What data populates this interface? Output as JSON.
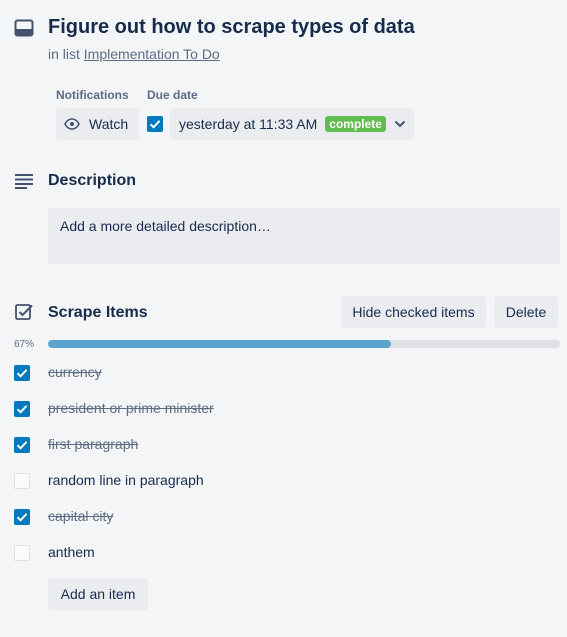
{
  "card": {
    "title": "Figure out how to scrape types of data",
    "in_list_prefix": "in list",
    "list_name": "Implementation To Do"
  },
  "notifications": {
    "label": "Notifications",
    "watch_label": "Watch"
  },
  "due_date": {
    "label": "Due date",
    "value": "yesterday at 11:33 AM",
    "status": "complete",
    "checked": true
  },
  "description": {
    "heading": "Description",
    "placeholder": "Add a more detailed description…"
  },
  "checklist": {
    "heading": "Scrape Items",
    "hide_checked_label": "Hide checked items",
    "delete_label": "Delete",
    "progress_percent_text": "67%",
    "progress_fraction": 0.67,
    "items": [
      {
        "text": "currency",
        "checked": true
      },
      {
        "text": "president or prime minister",
        "checked": true
      },
      {
        "text": "first paragraph",
        "checked": true
      },
      {
        "text": "random line in paragraph",
        "checked": false
      },
      {
        "text": "capital city",
        "checked": true
      },
      {
        "text": "anthem",
        "checked": false
      }
    ],
    "add_item_label": "Add an item"
  },
  "colors": {
    "accent": "#0079bf",
    "progress": "#5ba4cf",
    "complete_badge": "#61bd4f",
    "background": "#f4f5f7",
    "button_bg": "#ebecf0"
  }
}
